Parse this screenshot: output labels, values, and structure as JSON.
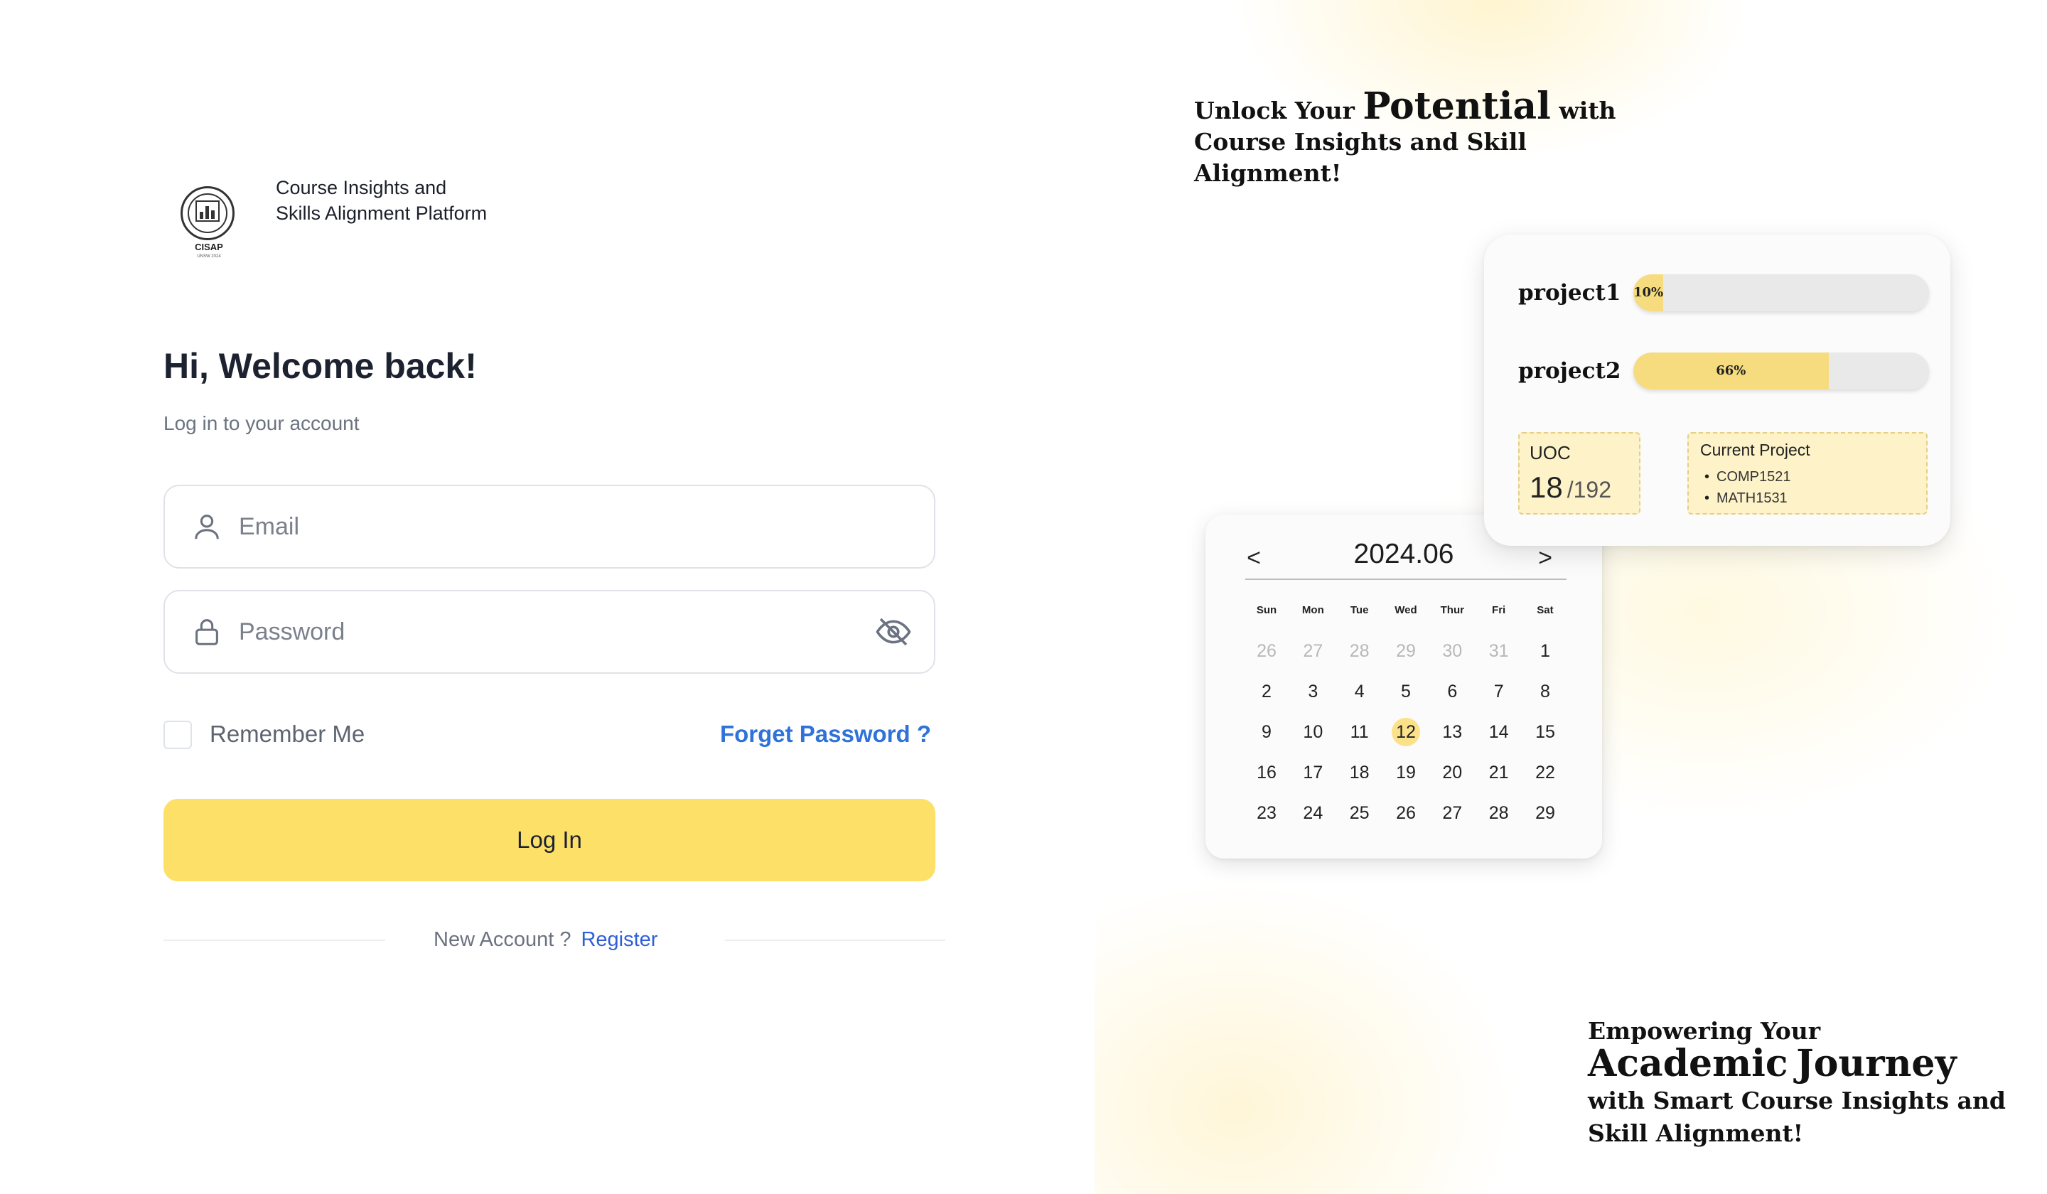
{
  "branding": {
    "logo_text": "CISAP",
    "logo_subtext": "UNSW 2024",
    "platform_name": "Course Insights and Skills Alignment Platform"
  },
  "login": {
    "title": "Hi, Welcome back!",
    "subtitle": "Log in to your account",
    "email_placeholder": "Email",
    "password_placeholder": "Password",
    "remember_label": "Remember Me",
    "forget_link": "Forget Password ?",
    "login_button": "Log In",
    "new_account_prompt": "New Account ?",
    "register_link": "Register"
  },
  "headlines": {
    "top_prefix": "Unlock Your",
    "top_emphasis": "Potential",
    "top_suffix": "with Course Insights and Skill Alignment!",
    "bottom_prefix": "Empowering Your",
    "bottom_emphasis_1": "Academic",
    "bottom_emphasis_2": "Journey",
    "bottom_suffix": "with Smart Course Insights and Skill Alignment!"
  },
  "calendar": {
    "title": "2024.06",
    "prev_label": "<",
    "next_label": ">",
    "weekdays": [
      "Sun",
      "Mon",
      "Tue",
      "Wed",
      "Thur",
      "Fri",
      "Sat"
    ],
    "weeks": [
      [
        "26",
        "27",
        "28",
        "29",
        "30",
        "31",
        "1"
      ],
      [
        "2",
        "3",
        "4",
        "5",
        "6",
        "7",
        "8"
      ],
      [
        "9",
        "10",
        "11",
        "12",
        "13",
        "14",
        "15"
      ],
      [
        "16",
        "17",
        "18",
        "19",
        "20",
        "21",
        "22"
      ],
      [
        "23",
        "24",
        "25",
        "26",
        "27",
        "28",
        "29"
      ]
    ],
    "today": "12"
  },
  "projects": {
    "items": [
      {
        "name": "project1",
        "progress": 0.1,
        "label": "10%"
      },
      {
        "name": "project2",
        "progress": 0.66,
        "label": "66%"
      }
    ],
    "uoc_label": "UOC",
    "uoc_value": "18",
    "uoc_total": "/192",
    "current_project_title": "Current Project",
    "current_projects": [
      "COMP1521",
      "MATH1531"
    ]
  },
  "colors": {
    "accent_yellow": "#fde068",
    "link_blue": "#2f73d8",
    "progress_fill": "#f6dc7e",
    "today_highlight": "#fbe28a"
  }
}
